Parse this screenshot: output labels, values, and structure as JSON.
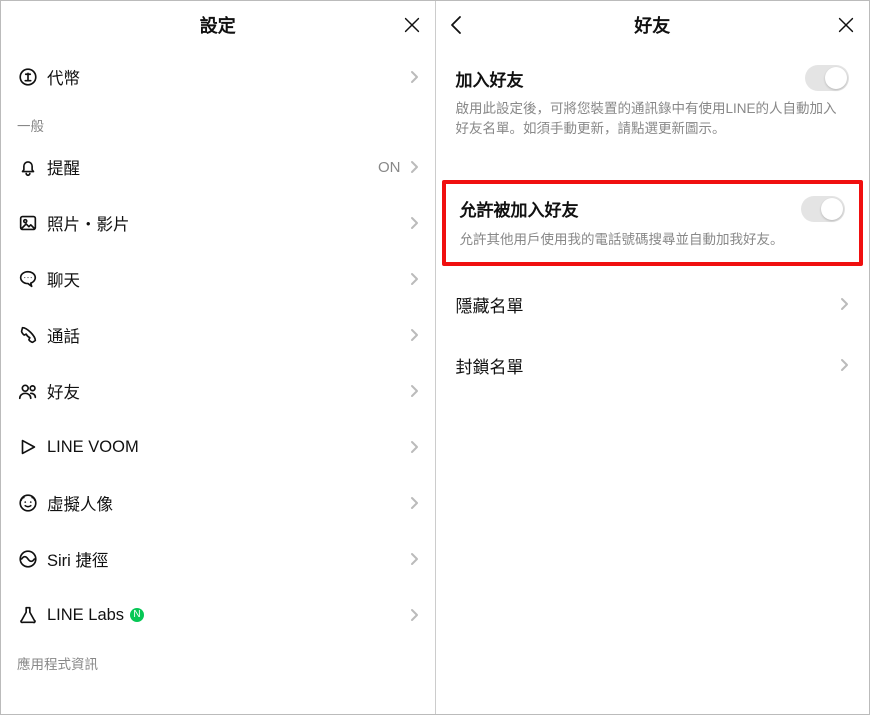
{
  "left": {
    "title": "設定",
    "rows": {
      "coins": "代幣",
      "notifications": "提醒",
      "notifications_value": "ON",
      "photos": "照片・影片",
      "chats": "聊天",
      "calls": "通話",
      "friends": "好友",
      "voom": "LINE VOOM",
      "avatar": "虛擬人像",
      "siri": "Siri 捷徑",
      "labs": "LINE Labs"
    },
    "labs_badge": "N",
    "section_general": "一般",
    "section_appinfo": "應用程式資訊"
  },
  "right": {
    "title": "好友",
    "auto_add": {
      "title": "加入好友",
      "desc": "啟用此設定後，可將您裝置的通訊錄中有使用LINE的人自動加入好友名單。如須手動更新，請點選更新圖示。"
    },
    "allow_add": {
      "title": "允許被加入好友",
      "desc": "允許其他用戶使用我的電話號碼搜尋並自動加我好友。"
    },
    "hidden_list": "隱藏名單",
    "blocked_list": "封鎖名單"
  }
}
